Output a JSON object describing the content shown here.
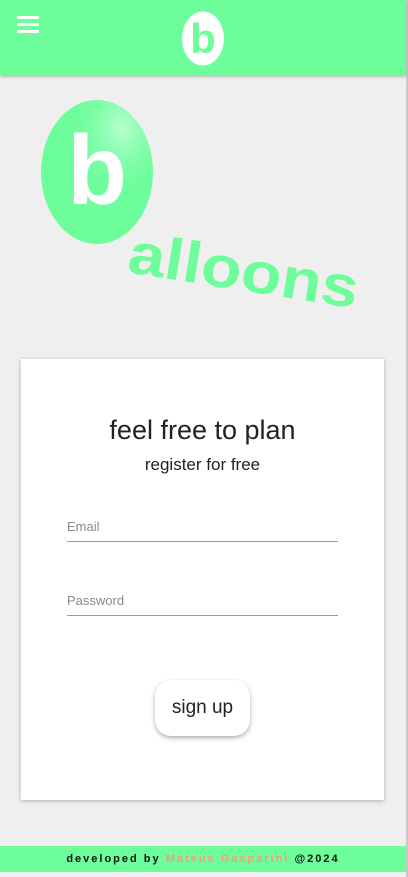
{
  "colors": {
    "brand_green": "#6dfd9b",
    "background": "#efefef",
    "author_accent": "#ff9a76"
  },
  "header": {
    "menu_icon": "hamburger-icon",
    "logo_letter": "b"
  },
  "hero": {
    "logo_letter": "b",
    "word_rest": "alloons"
  },
  "card": {
    "title": "feel free to plan",
    "subtitle": "register for free",
    "email_placeholder": "Email",
    "password_placeholder": "Password",
    "signup_label": "sign up"
  },
  "footer": {
    "prefix": "developed by ",
    "author": "Mateus Gasparini",
    "suffix": " @2024"
  }
}
